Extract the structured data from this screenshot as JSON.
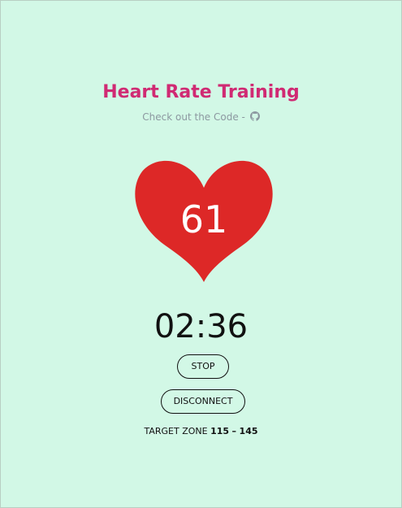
{
  "header": {
    "title": "Heart Rate Training",
    "subtitle": "Check out the Code -",
    "link_icon": "github-icon"
  },
  "heart": {
    "icon": "heart-icon",
    "color": "#dd2827",
    "bpm": "61"
  },
  "timer": "02:36",
  "buttons": {
    "stop_label": "STOP",
    "disconnect_label": "DISCONNECT"
  },
  "target_zone": {
    "label": "TARGET ZONE",
    "min": "115",
    "separator": "–",
    "max": "145"
  },
  "colors": {
    "background": "#d2f8e6",
    "title": "#d02a73",
    "subtitle": "#8c98a0"
  }
}
